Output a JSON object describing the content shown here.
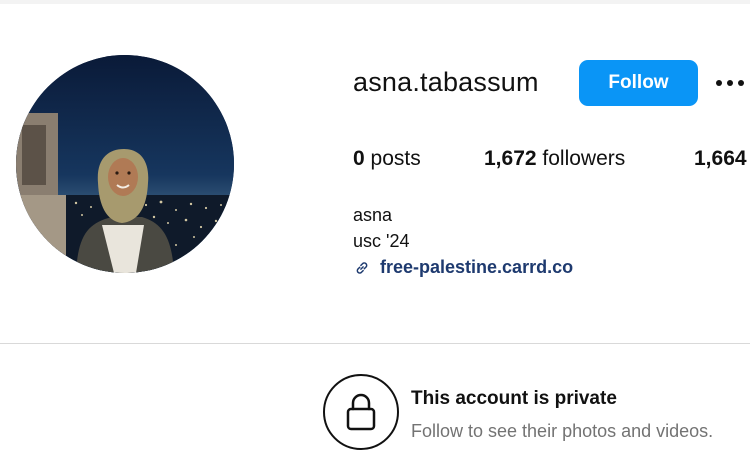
{
  "profile": {
    "username": "asna.tabassum",
    "follow_label": "Follow",
    "more_icon": "more-horizontal-icon",
    "stats": {
      "posts_count": "0",
      "posts_label": "posts",
      "followers_count": "1,672",
      "followers_label": "followers",
      "following_count": "1,664"
    },
    "full_name": "asna",
    "bio": "usc '24",
    "link_icon": "link-icon",
    "link_text": "free-palestine.carrd.co"
  },
  "private_notice": {
    "icon": "lock-icon",
    "title": "This account is private",
    "subtitle": "Follow to see their photos and videos."
  },
  "colors": {
    "follow_button": "#0a95f6",
    "link": "#1e3a6f",
    "muted_text": "#737373",
    "divider": "#d9d9d9"
  }
}
